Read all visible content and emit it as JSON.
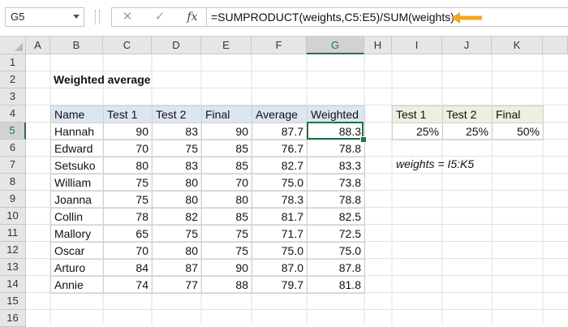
{
  "formula_bar": {
    "name_box": "G5",
    "cancel_icon": "✕",
    "enter_icon": "✓",
    "fx_label": "fx",
    "formula": "=SUMPRODUCT(weights,C5:E5)/SUM(weights)",
    "arrow_color": "#f5a623"
  },
  "columns": [
    "A",
    "B",
    "C",
    "D",
    "E",
    "F",
    "G",
    "H",
    "I",
    "J",
    "K"
  ],
  "rows": [
    "1",
    "2",
    "3",
    "4",
    "5",
    "6",
    "7",
    "8",
    "9",
    "10",
    "11",
    "12",
    "13",
    "14",
    "15",
    "16"
  ],
  "selected": {
    "column": "G",
    "row": "5"
  },
  "sheet": {
    "title": "Weighted average",
    "table_headers": [
      "Name",
      "Test 1",
      "Test 2",
      "Final",
      "Average",
      "Weighted"
    ],
    "table_rows": [
      [
        "Hannah",
        "90",
        "83",
        "90",
        "87.7",
        "88.3"
      ],
      [
        "Edward",
        "70",
        "75",
        "85",
        "76.7",
        "78.8"
      ],
      [
        "Setsuko",
        "80",
        "83",
        "85",
        "82.7",
        "83.3"
      ],
      [
        "William",
        "75",
        "80",
        "70",
        "75.0",
        "73.8"
      ],
      [
        "Joanna",
        "75",
        "80",
        "80",
        "78.3",
        "78.8"
      ],
      [
        "Collin",
        "78",
        "82",
        "85",
        "81.7",
        "82.5"
      ],
      [
        "Mallory",
        "65",
        "75",
        "75",
        "71.7",
        "72.5"
      ],
      [
        "Oscar",
        "70",
        "80",
        "75",
        "75.0",
        "75.0"
      ],
      [
        "Arturo",
        "84",
        "87",
        "90",
        "87.0",
        "87.8"
      ],
      [
        "Annie",
        "74",
        "77",
        "88",
        "79.7",
        "81.8"
      ]
    ],
    "weights_headers": [
      "Test 1",
      "Test 2",
      "Final"
    ],
    "weights_values": [
      "25%",
      "25%",
      "50%"
    ],
    "named_range_note": "weights = I5:K5"
  },
  "colors": {
    "header_blue": "#dce6f1",
    "header_green": "#ebf1de",
    "selection_green": "#217346"
  }
}
